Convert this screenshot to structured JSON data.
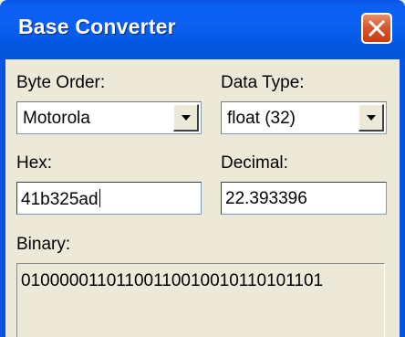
{
  "window": {
    "title": "Base Converter",
    "colors": {
      "titlebar": "#0a5ff0",
      "background": "#ece9d8",
      "close_button": "#d9572d"
    }
  },
  "close_button": {
    "icon": "close-icon"
  },
  "byte_order": {
    "label": "Byte Order:",
    "selected": "Motorola",
    "icon": "chevron-down-icon"
  },
  "data_type": {
    "label": "Data Type:",
    "selected": "float (32)",
    "icon": "chevron-down-icon"
  },
  "hex": {
    "label": "Hex:",
    "value": "41b325ad"
  },
  "decimal": {
    "label": "Decimal:",
    "value": "22.393396"
  },
  "binary": {
    "label": "Binary:",
    "value": "01000001101100110010010110101101"
  }
}
